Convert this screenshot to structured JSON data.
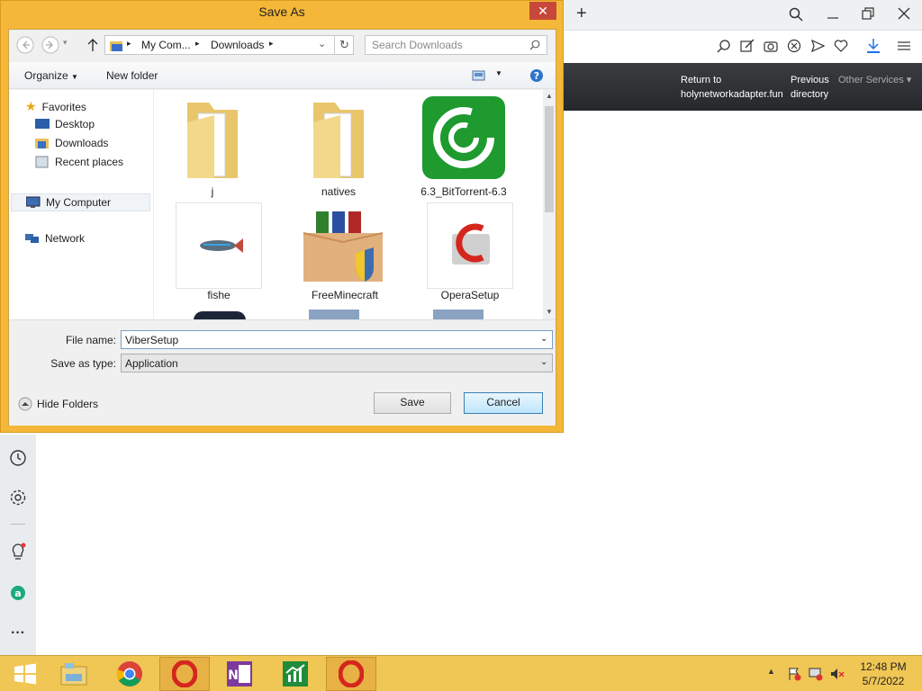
{
  "browser": {
    "new_tab": "+",
    "site_links": {
      "return_line1": "Return to",
      "return_line2": "holynetworkadapter.fun",
      "prev_line1": "Previous",
      "prev_line2": "directory",
      "other": "Other Services"
    }
  },
  "dialog": {
    "title": "Save As",
    "breadcrumb": [
      "My Com...",
      "Downloads"
    ],
    "search_placeholder": "Search Downloads",
    "organize": "Organize",
    "new_folder": "New folder",
    "tree": {
      "favorites": "Favorites",
      "desktop": "Desktop",
      "downloads": "Downloads",
      "recent": "Recent places",
      "computer": "My Computer",
      "network": "Network"
    },
    "files": [
      "j",
      "natives",
      "6.3_BitTorrent-6.3",
      "fishe",
      "FreeMinecraft",
      "OperaSetup"
    ],
    "file_name_label": "File name:",
    "file_name_value": "ViberSetup",
    "save_type_label": "Save as type:",
    "save_type_value": "Application",
    "hide_folders": "Hide Folders",
    "save": "Save",
    "cancel": "Cancel"
  },
  "taskbar": {
    "time": "12:48 PM",
    "date": "5/7/2022"
  },
  "colors": {
    "dialog_frame": "#f4b738",
    "taskbar": "#f0c654",
    "accent": "#1a73e8"
  }
}
